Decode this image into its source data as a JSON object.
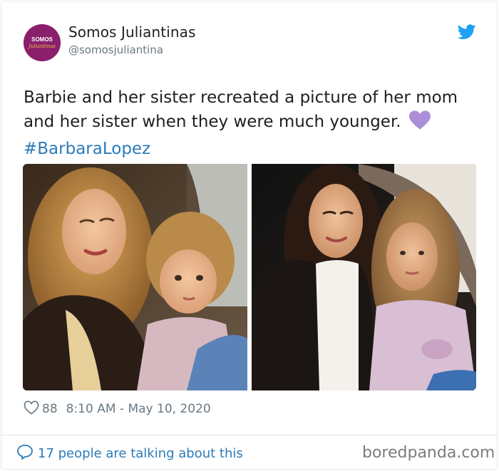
{
  "tweet": {
    "author_name": "Somos Juliantinas",
    "author_handle": "@somosjuliantina",
    "avatar_text_line1": "SOMOS",
    "avatar_text_line2": "Juliantinas",
    "text": "Barbie and her sister recreated a picture of her mom and her sister when they were much younger.",
    "emoji": "purple-heart",
    "hashtag": "#BarbaraLopez",
    "like_count": "88",
    "timestamp": "8:10 AM - May 10, 2020",
    "talking_text": "17 people are talking about this"
  },
  "icons": {
    "like": "heart-outline-icon",
    "comment": "comment-bubble-icon",
    "brand": "twitter-bird-icon"
  },
  "watermark": "boredpanda.com",
  "colors": {
    "link": "#2b7bb9",
    "muted": "#697882",
    "twitter_blue": "#1da1f2",
    "avatar_bg": "#8a1f6b",
    "purple_heart": "#ab8ed8"
  }
}
